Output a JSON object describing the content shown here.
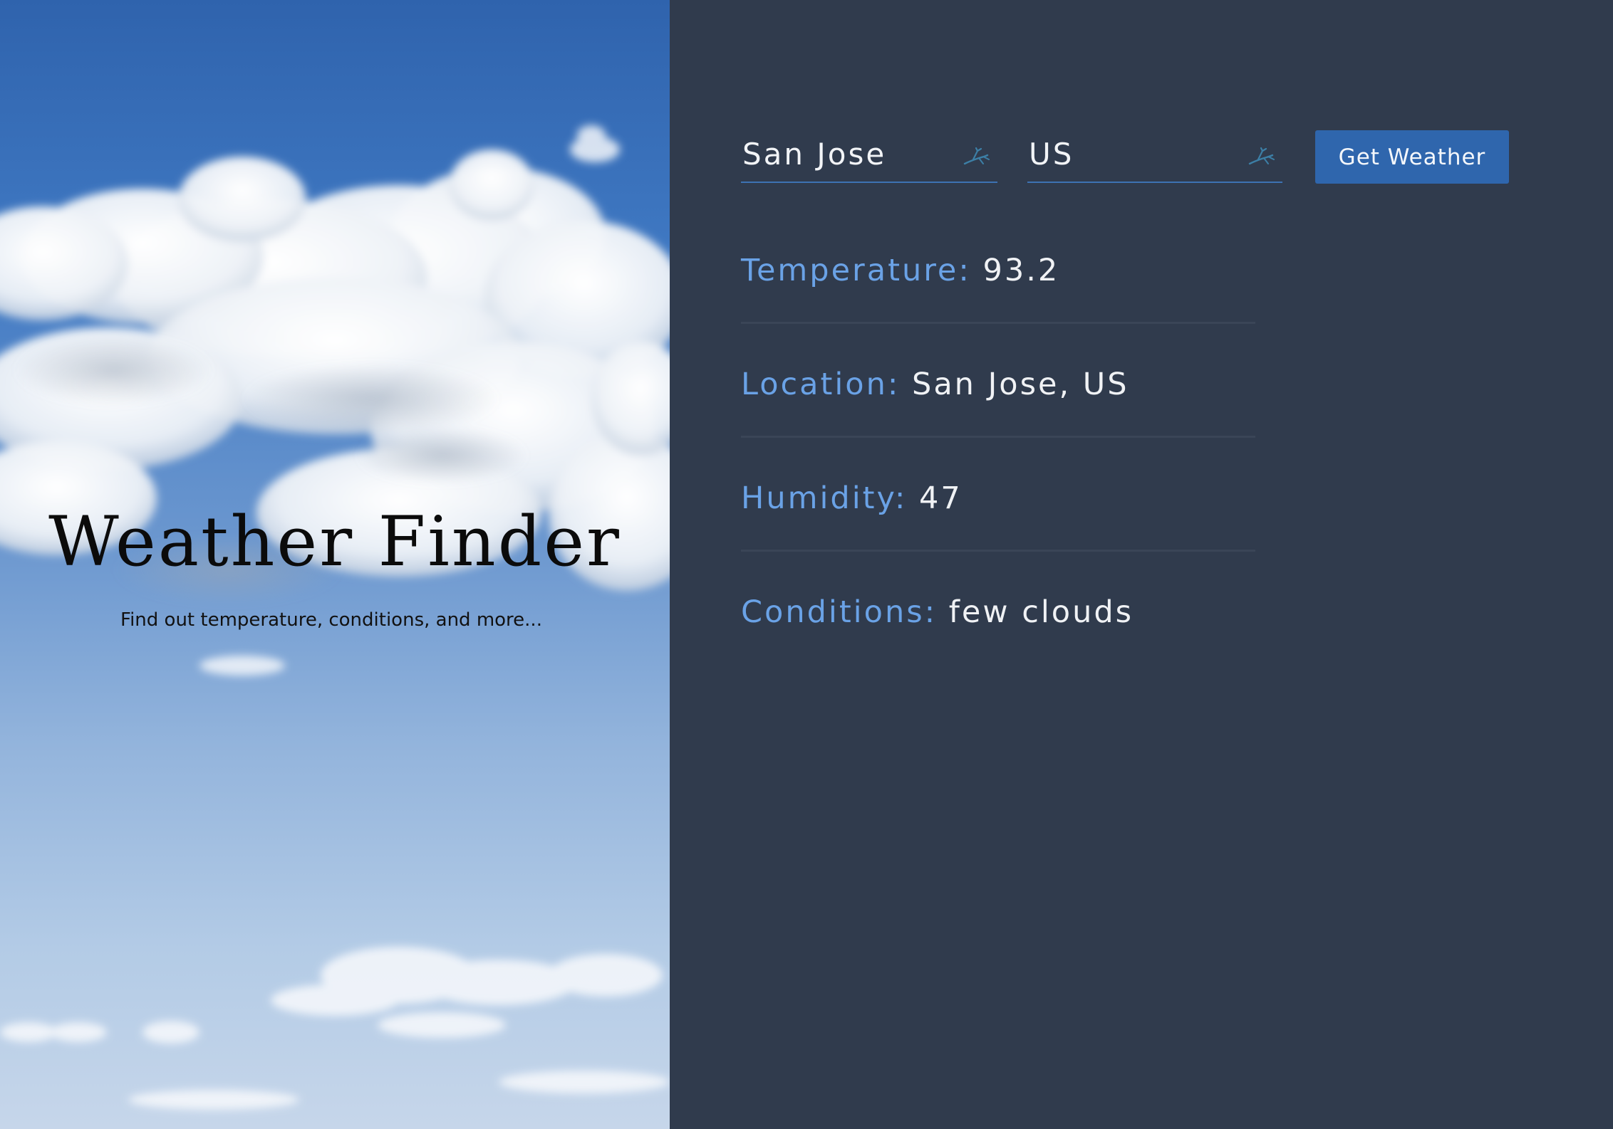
{
  "hero": {
    "title": "Weather Finder",
    "subtitle": "Find out temperature, conditions, and more..."
  },
  "form": {
    "city_value": "San Jose",
    "country_value": "US",
    "submit_label": "Get Weather"
  },
  "results": {
    "temperature": {
      "label": "Temperature:",
      "value": "93.2"
    },
    "location": {
      "label": "Location:",
      "value": "San Jose, US"
    },
    "humidity": {
      "label": "Humidity:",
      "value": "47"
    },
    "conditions": {
      "label": "Conditions:",
      "value": "few clouds"
    }
  },
  "colors": {
    "panel_bg": "#303b4d",
    "label_accent": "#6aa2e6",
    "button_bg": "#2f66ad",
    "field_underline": "#3d72b3"
  },
  "icons": {
    "field_icon": "gazelle-icon"
  }
}
